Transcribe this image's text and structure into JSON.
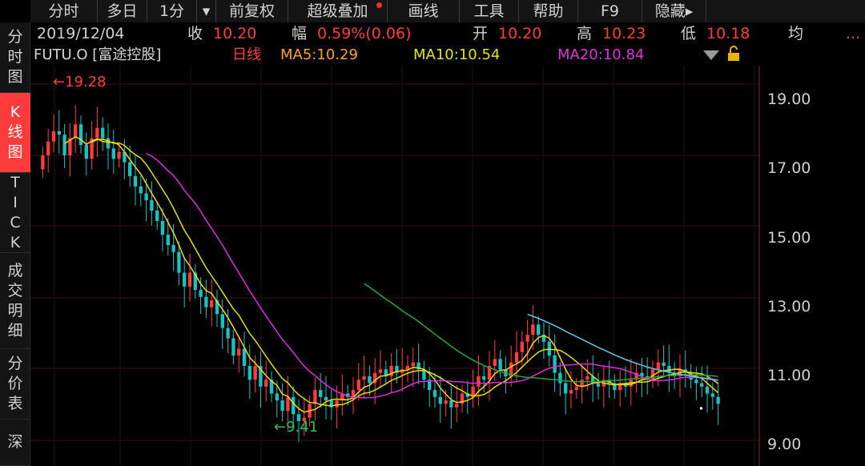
{
  "toolbar": {
    "items": [
      "分时",
      "多日",
      "1分",
      "▾",
      "前复权",
      "超级叠加",
      "画线",
      "工具",
      "帮助",
      "F9",
      "隐藏▸"
    ]
  },
  "sidebar": {
    "tabs": [
      "分时图",
      "K线图",
      "TICK",
      "成交明细",
      "分价表",
      "深"
    ],
    "active": "K线图"
  },
  "quote": {
    "date": "2019/12/04",
    "close_label": "收",
    "close": "10.20",
    "amp_label": "幅",
    "amp": "0.59%(0.06)",
    "open_label": "开",
    "open": "10.20",
    "high_label": "高",
    "high": "10.23",
    "low_label": "低",
    "low": "10.18",
    "avg_label": "均",
    "more": "..."
  },
  "legend": {
    "symbol": "FUTU.O [富途控股]",
    "period": "日线",
    "ma5": "MA5:10.29",
    "ma10": "MA10:10.54",
    "ma20": "MA20:10.84"
  },
  "colors": {
    "up": "#ff3c3c",
    "down": "#19c2c2",
    "ma5": "#ffd21a",
    "ma10": "#e0e000",
    "ma20": "#e02ae0",
    "ma60": "#1fa83a",
    "ma120": "#5ec8e6",
    "grid": "#3d1212"
  },
  "chart_data": {
    "type": "candlestick",
    "y_ticks": [
      "19.00",
      "17.00",
      "15.00",
      "13.00",
      "11.00",
      "9.00"
    ],
    "ylim": [
      8.4,
      20.0
    ],
    "high_annotation": "19.28",
    "low_annotation": "9.41",
    "close_series": [
      17.4,
      17.8,
      18.1,
      18.0,
      17.4,
      17.9,
      18.3,
      17.7,
      17.3,
      17.9,
      18.2,
      17.9,
      17.6,
      17.3,
      17.5,
      17.2,
      16.8,
      16.5,
      16.3,
      16.1,
      15.8,
      15.5,
      15.1,
      14.8,
      14.6,
      14.0,
      13.6,
      14.0,
      13.5,
      13.3,
      13.0,
      13.2,
      12.8,
      12.4,
      12.1,
      11.6,
      11.8,
      11.3,
      10.9,
      11.3,
      10.7,
      10.9,
      10.5,
      10.3,
      10.0,
      10.4,
      9.9,
      9.7,
      9.8,
      10.2,
      10.6,
      10.4,
      10.3,
      10.1,
      10.3,
      10.5,
      10.4,
      10.6,
      10.9,
      11.0,
      10.8,
      11.1,
      11.2,
      11.0,
      11.3,
      11.1,
      11.2,
      11.3,
      11.4,
      11.2,
      10.9,
      10.6,
      10.4,
      10.2,
      10.3,
      10.1,
      10.2,
      10.5,
      10.4,
      10.7,
      11.0,
      10.9,
      11.3,
      11.5,
      11.2,
      11.0,
      11.4,
      11.7,
      12.0,
      12.2,
      12.5,
      12.2,
      12.0,
      11.6,
      11.1,
      10.8,
      10.5,
      10.6,
      10.7,
      10.9,
      11.0,
      10.8,
      10.7,
      10.9,
      10.8,
      10.6,
      10.8,
      10.7,
      10.9,
      11.1,
      11.0,
      10.9,
      11.2,
      11.4,
      11.3,
      11.1,
      11.0,
      11.2,
      11.1,
      10.9,
      10.8,
      10.7,
      10.5,
      10.4,
      10.2
    ]
  }
}
